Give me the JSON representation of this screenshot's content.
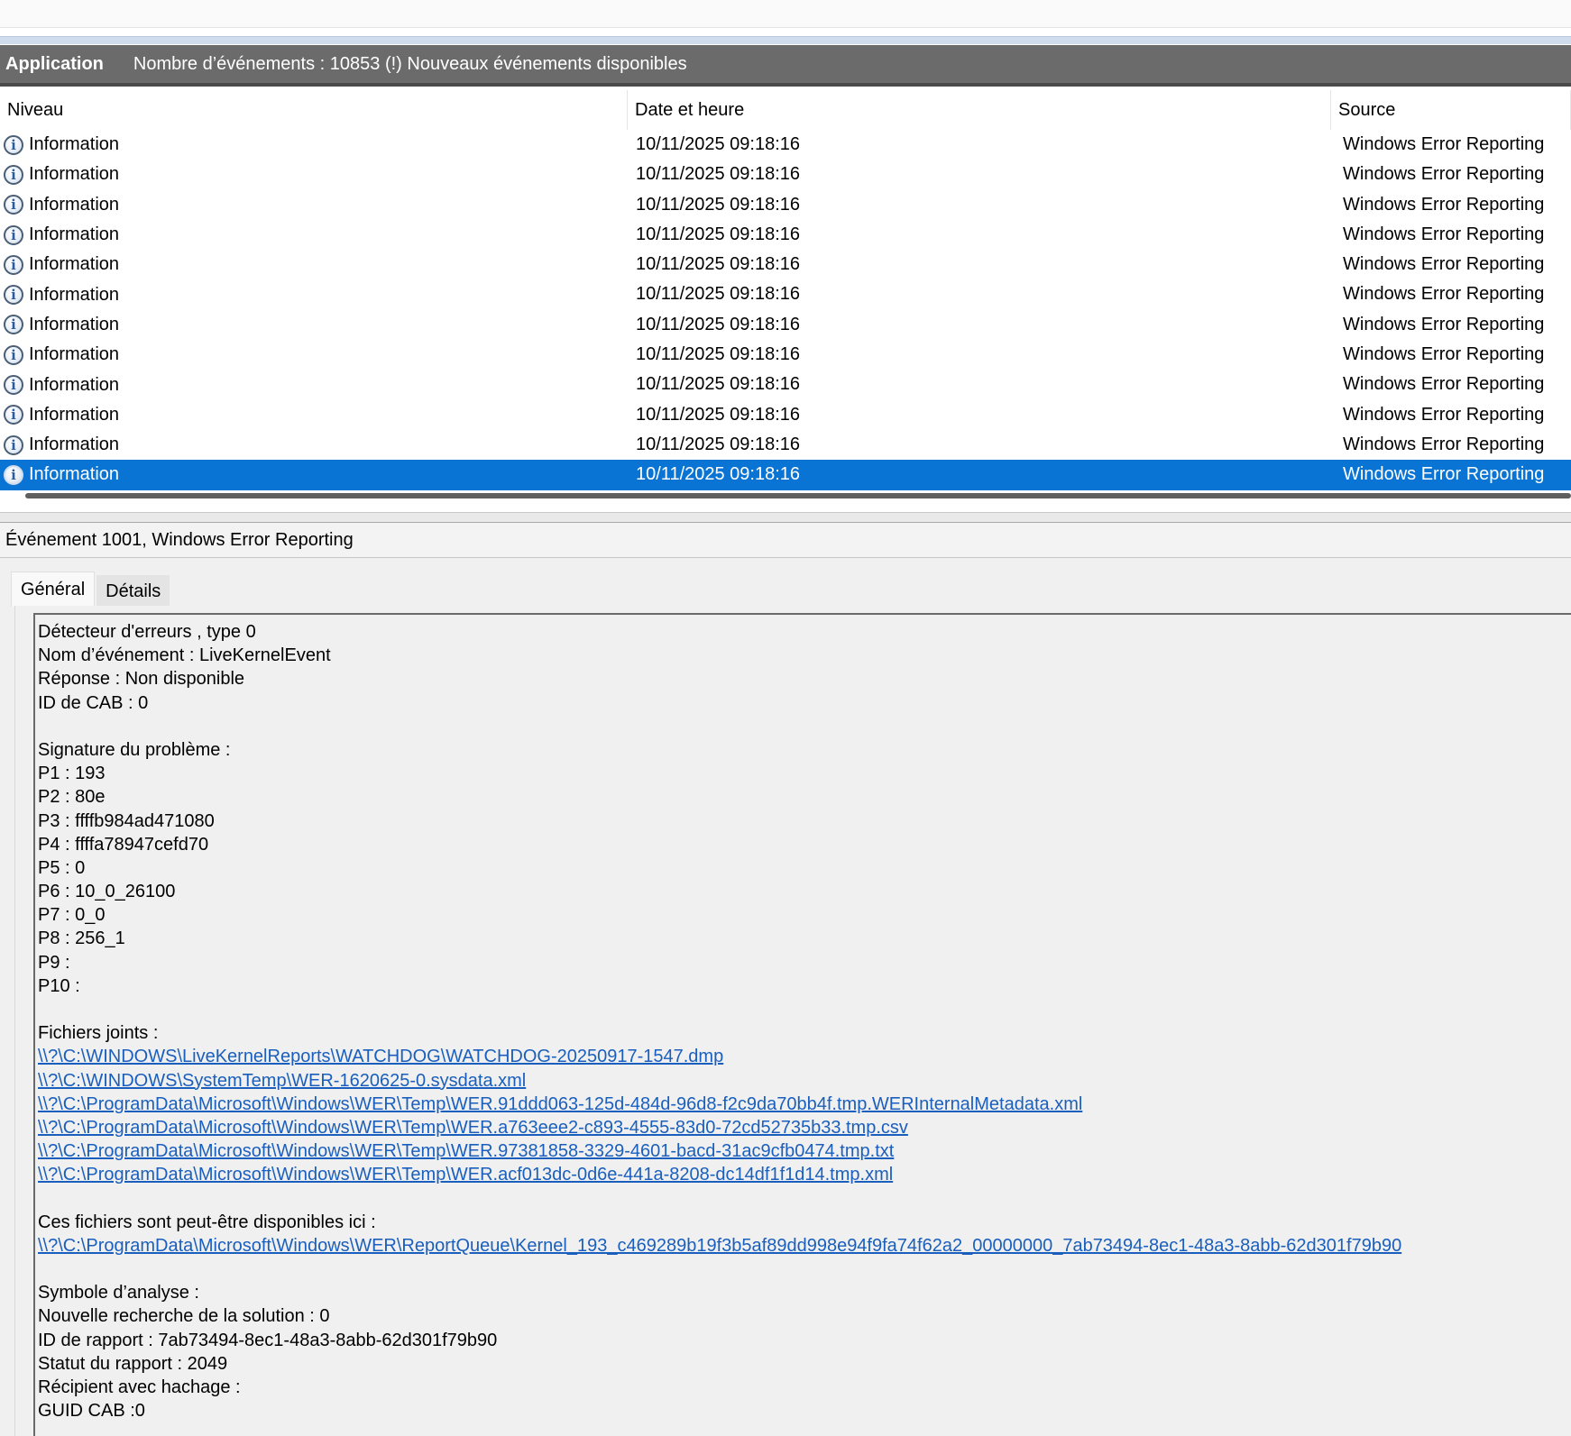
{
  "log_header": {
    "log_name": "Application",
    "summary": "Nombre d’événements : 10853 (!) Nouveaux événements disponibles"
  },
  "columns": {
    "level": "Niveau",
    "datetime": "Date et heure",
    "source": "Source"
  },
  "events": [
    {
      "level": "Information",
      "datetime": "10/11/2025 09:18:16",
      "source": "Windows Error Reporting"
    },
    {
      "level": "Information",
      "datetime": "10/11/2025 09:18:16",
      "source": "Windows Error Reporting"
    },
    {
      "level": "Information",
      "datetime": "10/11/2025 09:18:16",
      "source": "Windows Error Reporting"
    },
    {
      "level": "Information",
      "datetime": "10/11/2025 09:18:16",
      "source": "Windows Error Reporting"
    },
    {
      "level": "Information",
      "datetime": "10/11/2025 09:18:16",
      "source": "Windows Error Reporting"
    },
    {
      "level": "Information",
      "datetime": "10/11/2025 09:18:16",
      "source": "Windows Error Reporting"
    },
    {
      "level": "Information",
      "datetime": "10/11/2025 09:18:16",
      "source": "Windows Error Reporting"
    },
    {
      "level": "Information",
      "datetime": "10/11/2025 09:18:16",
      "source": "Windows Error Reporting"
    },
    {
      "level": "Information",
      "datetime": "10/11/2025 09:18:16",
      "source": "Windows Error Reporting"
    },
    {
      "level": "Information",
      "datetime": "10/11/2025 09:18:16",
      "source": "Windows Error Reporting"
    },
    {
      "level": "Information",
      "datetime": "10/11/2025 09:18:16",
      "source": "Windows Error Reporting"
    },
    {
      "level": "Information",
      "datetime": "10/11/2025 09:18:16",
      "source": "Windows Error Reporting",
      "selected": true
    }
  ],
  "info_icon_glyph": "i",
  "detail": {
    "title": "Événement 1001, Windows Error Reporting",
    "tabs": [
      {
        "label": "Général",
        "active": true
      },
      {
        "label": "Détails",
        "active": false
      }
    ],
    "lines": [
      {
        "text": "Détecteur d'erreurs , type 0"
      },
      {
        "text": "Nom d’événement : LiveKernelEvent"
      },
      {
        "text": "Réponse : Non disponible"
      },
      {
        "text": "ID de CAB : 0"
      },
      {
        "text": ""
      },
      {
        "text": "Signature du problème :"
      },
      {
        "text": "P1 : 193"
      },
      {
        "text": "P2 : 80e"
      },
      {
        "text": "P3 : ffffb984ad471080"
      },
      {
        "text": "P4 : ffffa78947cefd70"
      },
      {
        "text": "P5 : 0"
      },
      {
        "text": "P6 : 10_0_26100"
      },
      {
        "text": "P7 : 0_0"
      },
      {
        "text": "P8 : 256_1"
      },
      {
        "text": "P9 :"
      },
      {
        "text": "P10 :"
      },
      {
        "text": ""
      },
      {
        "text": "Fichiers joints :"
      },
      {
        "text": "\\\\?\\C:\\WINDOWS\\LiveKernelReports\\WATCHDOG\\WATCHDOG-20250917-1547.dmp",
        "link": true
      },
      {
        "text": "\\\\?\\C:\\WINDOWS\\SystemTemp\\WER-1620625-0.sysdata.xml",
        "link": true
      },
      {
        "text": "\\\\?\\C:\\ProgramData\\Microsoft\\Windows\\WER\\Temp\\WER.91ddd063-125d-484d-96d8-f2c9da70bb4f.tmp.WERInternalMetadata.xml",
        "link": true
      },
      {
        "text": "\\\\?\\C:\\ProgramData\\Microsoft\\Windows\\WER\\Temp\\WER.a763eee2-c893-4555-83d0-72cd52735b33.tmp.csv",
        "link": true
      },
      {
        "text": "\\\\?\\C:\\ProgramData\\Microsoft\\Windows\\WER\\Temp\\WER.97381858-3329-4601-bacd-31ac9cfb0474.tmp.txt",
        "link": true
      },
      {
        "text": "\\\\?\\C:\\ProgramData\\Microsoft\\Windows\\WER\\Temp\\WER.acf013dc-0d6e-441a-8208-dc14df1f1d14.tmp.xml",
        "link": true
      },
      {
        "text": ""
      },
      {
        "text": "Ces fichiers sont peut-être disponibles ici :"
      },
      {
        "text": "\\\\?\\C:\\ProgramData\\Microsoft\\Windows\\WER\\ReportQueue\\Kernel_193_c469289b19f3b5af89dd998e94f9fa74f62a2_00000000_7ab73494-8ec1-48a3-8abb-62d301f79b90",
        "link": true
      },
      {
        "text": ""
      },
      {
        "text": "Symbole d’analyse :"
      },
      {
        "text": "Nouvelle recherche de la solution : 0"
      },
      {
        "text": "ID de rapport : 7ab73494-8ec1-48a3-8abb-62d301f79b90"
      },
      {
        "text": "Statut du rapport : 2049"
      },
      {
        "text": "Récipient avec hachage :"
      },
      {
        "text": "GUID CAB :0"
      }
    ]
  }
}
